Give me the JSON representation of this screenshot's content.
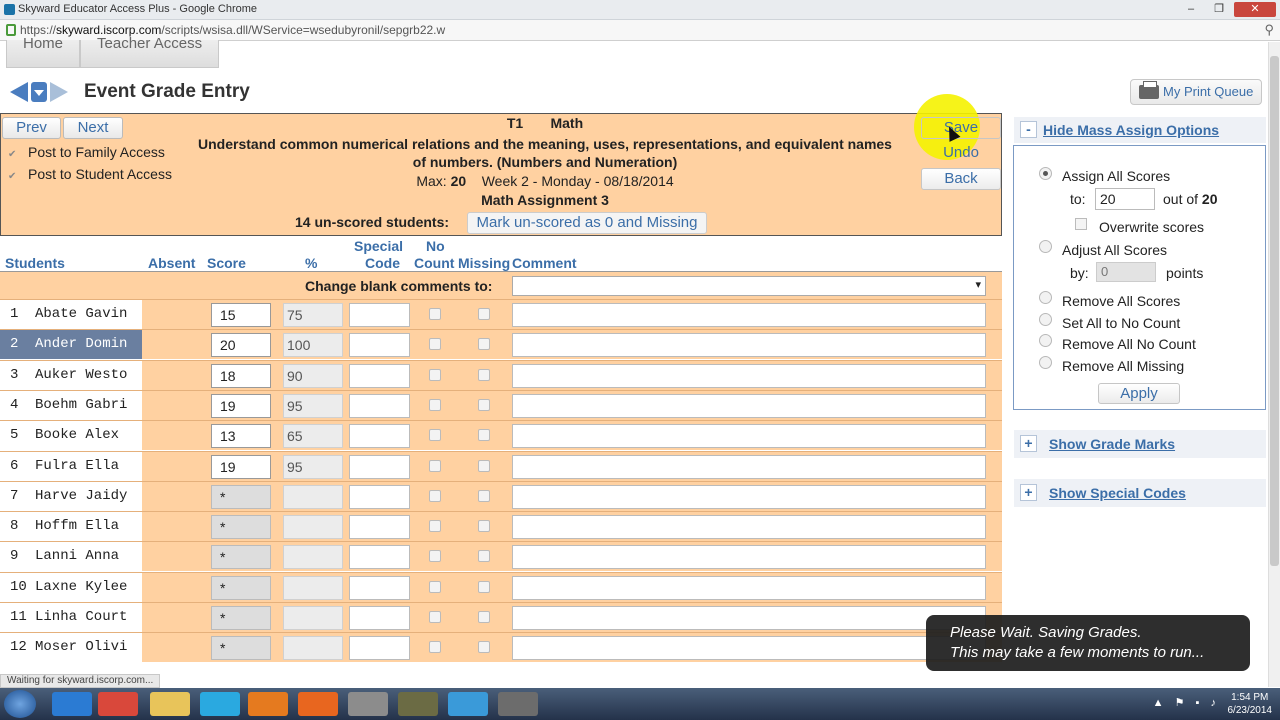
{
  "window": {
    "title": "Skyward Educator Access Plus - Google Chrome",
    "controls": [
      "–",
      "❐",
      "✕"
    ]
  },
  "browser": {
    "url_prefix": "https://",
    "url_host": "skyward.iscorp.com",
    "url_path": "/scripts/wsisa.dll/WService=wsedubyronil/sepgrb22.w",
    "zoom_glyph": "⚲"
  },
  "nav": {
    "tabs": [
      "Home",
      "Teacher Access"
    ]
  },
  "page": {
    "title": "Event Grade Entry",
    "print_queue": "My Print Queue"
  },
  "info": {
    "prev": "Prev",
    "next": "Next",
    "post_family": "Post to Family Access",
    "post_student": "Post to Student Access",
    "term": "T1",
    "subject": "Math",
    "standard": "Understand common numerical relations and the meaning, uses, representations, and equivalent names of numbers. (Numbers and Numeration)",
    "max_label": "Max:",
    "max_value": "20",
    "week": "Week 2 - Monday - 08/18/2014",
    "assignment": "Math Assignment 3",
    "unscored": "14 un-scored students:",
    "mark_unscored": "Mark un-scored as 0 and Missing"
  },
  "actions": {
    "save": "Save",
    "undo": "Undo",
    "back": "Back"
  },
  "table": {
    "headers": {
      "students": "Students",
      "absent": "Absent",
      "score": "Score",
      "pct": "%",
      "special_1": "Special",
      "special_2": "Code",
      "nocount_1": "No",
      "nocount_2": "Count",
      "missing": "Missing",
      "comment": "Comment"
    },
    "blank_comments_label": "Change blank comments to:",
    "rows": [
      {
        "num": "1",
        "name": "Abate Gavin",
        "score": "15",
        "pct": "75"
      },
      {
        "num": "2",
        "name": "Ander Domin",
        "score": "20",
        "pct": "100"
      },
      {
        "num": "3",
        "name": "Auker Westo",
        "score": "18",
        "pct": "90"
      },
      {
        "num": "4",
        "name": "Boehm Gabri",
        "score": "19",
        "pct": "95"
      },
      {
        "num": "5",
        "name": "Booke Alex",
        "score": "13",
        "pct": "65"
      },
      {
        "num": "6",
        "name": "Fulra Ella",
        "score": "19",
        "pct": "95"
      },
      {
        "num": "7",
        "name": "Harve Jaidy",
        "score": "*",
        "pct": ""
      },
      {
        "num": "8",
        "name": "Hoffm Ella",
        "score": "*",
        "pct": ""
      },
      {
        "num": "9",
        "name": "Lanni Anna",
        "score": "*",
        "pct": ""
      },
      {
        "num": "10",
        "name": "Laxne Kylee",
        "score": "*",
        "pct": ""
      },
      {
        "num": "11",
        "name": "Linha Court",
        "score": "*",
        "pct": ""
      },
      {
        "num": "12",
        "name": "Moser Olivi",
        "score": "*",
        "pct": ""
      }
    ]
  },
  "mass_assign": {
    "hide_label": "Hide Mass Assign Options",
    "assign_all": "Assign All Scores",
    "to_label": "to:",
    "to_value": "20",
    "out_of_label": "out of",
    "out_of_value": "20",
    "overwrite": "Overwrite scores",
    "adjust_all": "Adjust All Scores",
    "by_label": "by:",
    "by_value": "0",
    "points": "points",
    "remove_all": "Remove All Scores",
    "set_no_count": "Set All to No Count",
    "remove_no_count": "Remove All No Count",
    "remove_missing": "Remove All Missing",
    "apply": "Apply",
    "show_grade_marks": "Show Grade Marks",
    "show_special_codes": "Show Special Codes"
  },
  "toast": {
    "line1": "Please Wait.  Saving Grades.",
    "line2": "This may take a few moments to run..."
  },
  "status_text": "Waiting for skyward.iscorp.com...",
  "taskbar": {
    "time": "1:54 PM",
    "date": "6/23/2014"
  },
  "colors": {
    "orange_panel": "#ffd1a1",
    "link_blue": "#3b6ea8",
    "highlight_yellow": "#f5f200"
  }
}
